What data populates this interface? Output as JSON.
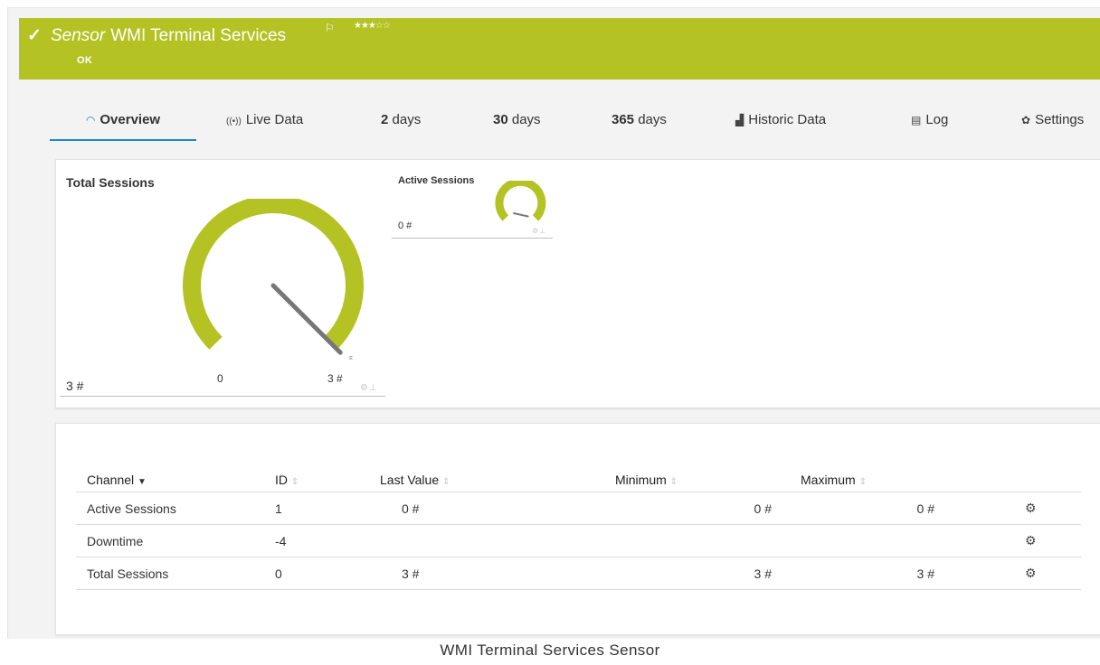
{
  "header": {
    "check_icon": "checkmark-icon",
    "kind": "Sensor",
    "name": "WMI Terminal Services",
    "flag_icon": "flag-icon",
    "stars_filled": "★★★",
    "stars_empty": "☆☆",
    "priority_stars": 3,
    "status": "OK",
    "color": "#b4c323"
  },
  "tabs": [
    {
      "icon": "gauge-icon",
      "glyph": "◠",
      "label": "Overview",
      "active": true
    },
    {
      "icon": "live-data-icon",
      "glyph": "((•))",
      "label": "Live Data"
    },
    {
      "num": "2",
      "label": "days"
    },
    {
      "num": "30",
      "label": "days"
    },
    {
      "num": "365",
      "label": "days"
    },
    {
      "icon": "area-chart-icon",
      "glyph": "▟",
      "label": "Historic Data"
    },
    {
      "icon": "list-icon",
      "glyph": "▤",
      "label": "Log"
    },
    {
      "icon": "gear-icon",
      "glyph": "✿",
      "label": "Settings"
    }
  ],
  "gauges": {
    "total": {
      "title": "Total Sessions",
      "value": "3 #",
      "scale_min": "0",
      "scale_max": "3 #",
      "level": 1.0,
      "color": "#b4c323"
    },
    "active": {
      "title": "Active Sessions",
      "value": "0 #",
      "level": 0.0,
      "color": "#b4c323"
    }
  },
  "table": {
    "headers": [
      "Channel",
      "ID",
      "Last Value",
      "Minimum",
      "Maximum"
    ],
    "sort_desc": "▼",
    "sort_both": "⇕",
    "gear_glyph": "⚙",
    "rows": [
      {
        "channel": "Active Sessions",
        "id": "1",
        "last": "0 #",
        "min": "0 #",
        "max": "0 #"
      },
      {
        "channel": "Downtime",
        "id": "-4",
        "last": "",
        "min": "",
        "max": ""
      },
      {
        "channel": "Total Sessions",
        "id": "0",
        "last": "3 #",
        "min": "3 #",
        "max": "3 #"
      }
    ]
  },
  "caption": "WMI Terminal Services Sensor"
}
